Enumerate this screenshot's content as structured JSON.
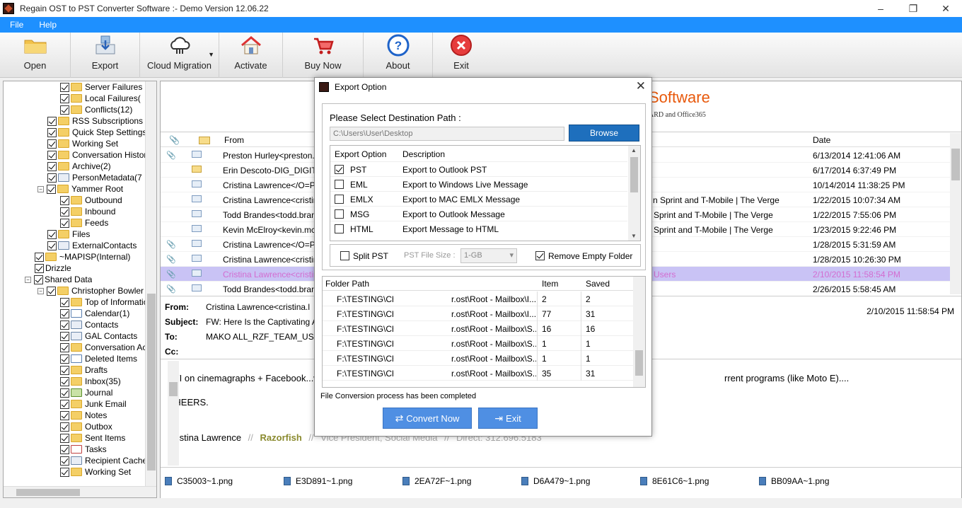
{
  "window": {
    "title": "Regain OST to PST Converter Software :- Demo Version 12.06.22",
    "controls": [
      "–",
      "❐",
      "✕"
    ]
  },
  "menu": [
    "File",
    "Help"
  ],
  "toolbar": [
    {
      "label": "Open",
      "icon": "folder-icon"
    },
    {
      "label": "Export",
      "icon": "export-icon"
    },
    {
      "label": "Cloud Migration",
      "icon": "cloud-migration-icon"
    },
    {
      "label": "Activate",
      "icon": "home-icon"
    },
    {
      "label": "Buy Now",
      "icon": "cart-icon"
    },
    {
      "label": "About",
      "icon": "help-icon"
    },
    {
      "label": "Exit",
      "icon": "exit-icon"
    }
  ],
  "tree": [
    {
      "label": "Server Failures",
      "indent": 3,
      "icon": "folder"
    },
    {
      "label": "Local Failures(",
      "indent": 3,
      "icon": "folder"
    },
    {
      "label": "Conflicts(12)",
      "indent": 3,
      "icon": "folder"
    },
    {
      "label": "RSS Subscriptions",
      "indent": 2,
      "icon": "folder"
    },
    {
      "label": "Quick Step Settings",
      "indent": 2,
      "icon": "folder"
    },
    {
      "label": "Working Set",
      "indent": 2,
      "icon": "folder"
    },
    {
      "label": "Conversation History",
      "indent": 2,
      "icon": "folder"
    },
    {
      "label": "Archive(2)",
      "indent": 2,
      "icon": "folder"
    },
    {
      "label": "PersonMetadata(7",
      "indent": 2,
      "icon": "contact"
    },
    {
      "label": "Yammer Root",
      "indent": 2,
      "icon": "folder",
      "expander": "−"
    },
    {
      "label": "Outbound",
      "indent": 3,
      "icon": "folder"
    },
    {
      "label": "Inbound",
      "indent": 3,
      "icon": "folder"
    },
    {
      "label": "Feeds",
      "indent": 3,
      "icon": "folder"
    },
    {
      "label": "Files",
      "indent": 2,
      "icon": "folder"
    },
    {
      "label": "ExternalContacts",
      "indent": 2,
      "icon": "contact"
    },
    {
      "label": "~MAPISP(Internal)",
      "indent": 1,
      "icon": "folder"
    },
    {
      "label": "Drizzle",
      "indent": 1,
      "icon": "none"
    },
    {
      "label": "Shared Data",
      "indent": 1,
      "icon": "none",
      "expander": "−"
    },
    {
      "label": "Christopher Bowler",
      "indent": 2,
      "icon": "folder",
      "expander": "−"
    },
    {
      "label": "Top of Information",
      "indent": 3,
      "icon": "folder"
    },
    {
      "label": "Calendar(1)",
      "indent": 3,
      "icon": "calendar"
    },
    {
      "label": "Contacts",
      "indent": 3,
      "icon": "contact"
    },
    {
      "label": "GAL Contacts",
      "indent": 3,
      "icon": "contact"
    },
    {
      "label": "Conversation Actions",
      "indent": 3,
      "icon": "folder"
    },
    {
      "label": "Deleted Items",
      "indent": 3,
      "icon": "deleted"
    },
    {
      "label": "Drafts",
      "indent": 3,
      "icon": "folder"
    },
    {
      "label": "Inbox(35)",
      "indent": 3,
      "icon": "folder"
    },
    {
      "label": "Journal",
      "indent": 3,
      "icon": "journal"
    },
    {
      "label": "Junk Email",
      "indent": 3,
      "icon": "folder"
    },
    {
      "label": "Notes",
      "indent": 3,
      "icon": "folder"
    },
    {
      "label": "Outbox",
      "indent": 3,
      "icon": "folder"
    },
    {
      "label": "Sent Items",
      "indent": 3,
      "icon": "folder"
    },
    {
      "label": "Tasks",
      "indent": 3,
      "icon": "tasks"
    },
    {
      "label": "Recipient Cache",
      "indent": 3,
      "icon": "contact"
    },
    {
      "label": "Working Set",
      "indent": 3,
      "icon": "folder"
    }
  ],
  "banner": {
    "line1": "Software",
    "line2": "ARD and Office365"
  },
  "grid": {
    "headers": {
      "from": "From",
      "date": "Date"
    },
    "rows": [
      {
        "attach": true,
        "env": "read",
        "from": "Preston Hurley<preston.hurl",
        "subject": "",
        "date": "6/13/2014 12:41:06 AM"
      },
      {
        "attach": false,
        "env": "yellow",
        "from": "Erin Descoto-DIG_DIGITAS",
        "subject": "",
        "date": "6/17/2014 6:37:49 PM"
      },
      {
        "attach": false,
        "env": "read",
        "from": "Cristina Lawrence</O=PUB",
        "subject": "",
        "date": "10/14/2014 11:38:25 PM"
      },
      {
        "attach": false,
        "env": "read",
        "from": "Cristina Lawrence<cristina.la",
        "subject": "n Sprint and T-Mobile | The Verge",
        "date": "1/22/2015 10:07:34 AM"
      },
      {
        "attach": false,
        "env": "read",
        "from": "Todd Brandes<todd.brande",
        "subject": "Sprint and T-Mobile | The Verge",
        "date": "1/22/2015 7:55:06 PM"
      },
      {
        "attach": false,
        "env": "read",
        "from": "Kevin McElroy<kevin.mcelro",
        "subject": "Sprint and T-Mobile | The Verge",
        "date": "1/23/2015 9:22:46 PM"
      },
      {
        "attach": true,
        "env": "read",
        "from": "Cristina Lawrence</O=PUB",
        "subject": "",
        "date": "1/28/2015 5:31:59 AM"
      },
      {
        "attach": true,
        "env": "read",
        "from": "Cristina Lawrence<cristina.la",
        "subject": "",
        "date": "1/28/2015 10:26:30 PM"
      },
      {
        "attach": true,
        "env": "read",
        "from": "Cristina Lawrence<cristina.la",
        "subject": "Users",
        "date": "2/10/2015 11:58:54 PM",
        "selected": true
      },
      {
        "attach": true,
        "env": "read",
        "from": "Todd Brandes<todd.brande",
        "subject": "",
        "date": "2/26/2015 5:58:45 AM"
      }
    ]
  },
  "mail": {
    "from_label": "From:",
    "from": "Cristina Lawrence<cristina.l",
    "subject_label": "Subject:",
    "subject": "FW: Here Is the Captivating Ad F",
    "to_label": "To:",
    "to": "MAKO ALL_RZF_TEAM_USA<",
    "cc_label": "Cc:",
    "date": "2/10/2015 11:58:54 PM",
    "body_line1": "FYI on cinemagraphs + Facebook...we",
    "body_line1_cont": "rrent programs (like Moto E)....",
    "body_line2": "CHEERS.",
    "sig_name": "Cristina Lawrence",
    "sig_sep": "//",
    "sig_company": "Razorfish",
    "sig_title": "Vice President, Social Media",
    "sig_direct": "Direct: 312.696.5183"
  },
  "attachments": [
    "C35003~1.png",
    "E3D891~1.png",
    "2EA72F~1.png",
    "D6A479~1.png",
    "8E61C6~1.png",
    "BB09AA~1.png"
  ],
  "dialog": {
    "title": "Export Option",
    "dest_label": "Please Select Destination Path :",
    "path": "C:\\Users\\User\\Desktop",
    "browse": "Browse",
    "opt_headers": {
      "option": "Export Option",
      "desc": "Description"
    },
    "options": [
      {
        "name": "PST",
        "desc": "Export to Outlook PST",
        "checked": true
      },
      {
        "name": "EML",
        "desc": "Export to Windows Live Message",
        "checked": false
      },
      {
        "name": "EMLX",
        "desc": "Export to MAC EMLX Message",
        "checked": false
      },
      {
        "name": "MSG",
        "desc": "Export to Outlook Message",
        "checked": false
      },
      {
        "name": "HTML",
        "desc": "Export Message to HTML",
        "checked": false
      }
    ],
    "split_label": "Split PST",
    "split_checked": false,
    "size_label": "PST File Size :",
    "size_value": "1-GB",
    "remove_empty_label": "Remove Empty Folder",
    "remove_empty_checked": true,
    "results_headers": {
      "path": "Folder Path",
      "item": "Item",
      "saved": "Saved"
    },
    "results": [
      {
        "path1": "F:\\TESTING\\Ch",
        "path2": "r.ost\\Root - Mailbox\\I...",
        "item": "2",
        "saved": "2"
      },
      {
        "path1": "F:\\TESTING\\Ch",
        "path2": "r.ost\\Root - Mailbox\\I...",
        "item": "77",
        "saved": "31"
      },
      {
        "path1": "F:\\TESTING\\Ch",
        "path2": "r.ost\\Root - Mailbox\\S...",
        "item": "16",
        "saved": "16"
      },
      {
        "path1": "F:\\TESTING\\Ch",
        "path2": "r.ost\\Root - Mailbox\\S...",
        "item": "1",
        "saved": "1"
      },
      {
        "path1": "F:\\TESTING\\Ch",
        "path2": "r.ost\\Root - Mailbox\\S...",
        "item": "1",
        "saved": "1"
      },
      {
        "path1": "F:\\TESTING\\Ch",
        "path2": "r.ost\\Root - Mailbox\\S...",
        "item": "35",
        "saved": "31"
      }
    ],
    "status": "File Conversion process has been completed",
    "convert_label": "Convert Now",
    "exit_label": "Exit"
  }
}
